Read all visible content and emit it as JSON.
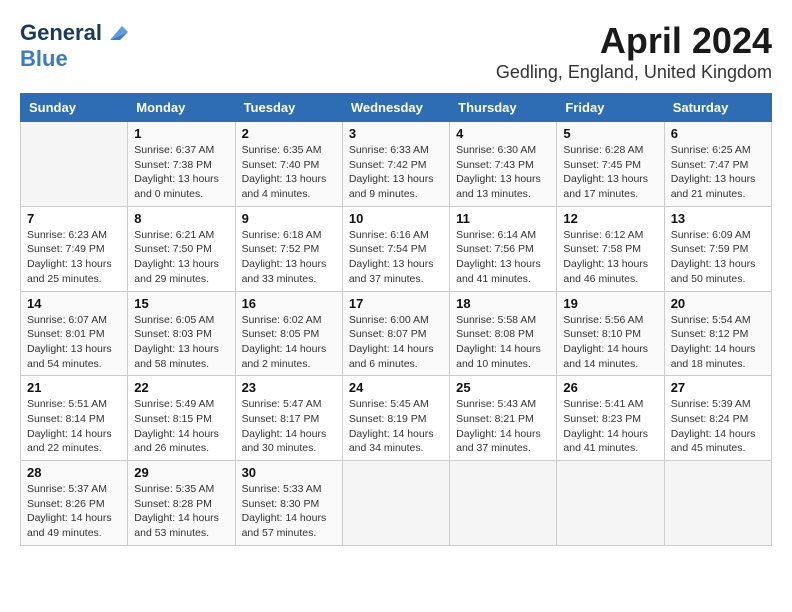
{
  "logo": {
    "general": "General",
    "blue": "Blue"
  },
  "title": "April 2024",
  "subtitle": "Gedling, England, United Kingdom",
  "days_of_week": [
    "Sunday",
    "Monday",
    "Tuesday",
    "Wednesday",
    "Thursday",
    "Friday",
    "Saturday"
  ],
  "weeks": [
    [
      {
        "day": "",
        "sunrise": "",
        "sunset": "",
        "daylight": ""
      },
      {
        "day": "1",
        "sunrise": "Sunrise: 6:37 AM",
        "sunset": "Sunset: 7:38 PM",
        "daylight": "Daylight: 13 hours and 0 minutes."
      },
      {
        "day": "2",
        "sunrise": "Sunrise: 6:35 AM",
        "sunset": "Sunset: 7:40 PM",
        "daylight": "Daylight: 13 hours and 4 minutes."
      },
      {
        "day": "3",
        "sunrise": "Sunrise: 6:33 AM",
        "sunset": "Sunset: 7:42 PM",
        "daylight": "Daylight: 13 hours and 9 minutes."
      },
      {
        "day": "4",
        "sunrise": "Sunrise: 6:30 AM",
        "sunset": "Sunset: 7:43 PM",
        "daylight": "Daylight: 13 hours and 13 minutes."
      },
      {
        "day": "5",
        "sunrise": "Sunrise: 6:28 AM",
        "sunset": "Sunset: 7:45 PM",
        "daylight": "Daylight: 13 hours and 17 minutes."
      },
      {
        "day": "6",
        "sunrise": "Sunrise: 6:25 AM",
        "sunset": "Sunset: 7:47 PM",
        "daylight": "Daylight: 13 hours and 21 minutes."
      }
    ],
    [
      {
        "day": "7",
        "sunrise": "Sunrise: 6:23 AM",
        "sunset": "Sunset: 7:49 PM",
        "daylight": "Daylight: 13 hours and 25 minutes."
      },
      {
        "day": "8",
        "sunrise": "Sunrise: 6:21 AM",
        "sunset": "Sunset: 7:50 PM",
        "daylight": "Daylight: 13 hours and 29 minutes."
      },
      {
        "day": "9",
        "sunrise": "Sunrise: 6:18 AM",
        "sunset": "Sunset: 7:52 PM",
        "daylight": "Daylight: 13 hours and 33 minutes."
      },
      {
        "day": "10",
        "sunrise": "Sunrise: 6:16 AM",
        "sunset": "Sunset: 7:54 PM",
        "daylight": "Daylight: 13 hours and 37 minutes."
      },
      {
        "day": "11",
        "sunrise": "Sunrise: 6:14 AM",
        "sunset": "Sunset: 7:56 PM",
        "daylight": "Daylight: 13 hours and 41 minutes."
      },
      {
        "day": "12",
        "sunrise": "Sunrise: 6:12 AM",
        "sunset": "Sunset: 7:58 PM",
        "daylight": "Daylight: 13 hours and 46 minutes."
      },
      {
        "day": "13",
        "sunrise": "Sunrise: 6:09 AM",
        "sunset": "Sunset: 7:59 PM",
        "daylight": "Daylight: 13 hours and 50 minutes."
      }
    ],
    [
      {
        "day": "14",
        "sunrise": "Sunrise: 6:07 AM",
        "sunset": "Sunset: 8:01 PM",
        "daylight": "Daylight: 13 hours and 54 minutes."
      },
      {
        "day": "15",
        "sunrise": "Sunrise: 6:05 AM",
        "sunset": "Sunset: 8:03 PM",
        "daylight": "Daylight: 13 hours and 58 minutes."
      },
      {
        "day": "16",
        "sunrise": "Sunrise: 6:02 AM",
        "sunset": "Sunset: 8:05 PM",
        "daylight": "Daylight: 14 hours and 2 minutes."
      },
      {
        "day": "17",
        "sunrise": "Sunrise: 6:00 AM",
        "sunset": "Sunset: 8:07 PM",
        "daylight": "Daylight: 14 hours and 6 minutes."
      },
      {
        "day": "18",
        "sunrise": "Sunrise: 5:58 AM",
        "sunset": "Sunset: 8:08 PM",
        "daylight": "Daylight: 14 hours and 10 minutes."
      },
      {
        "day": "19",
        "sunrise": "Sunrise: 5:56 AM",
        "sunset": "Sunset: 8:10 PM",
        "daylight": "Daylight: 14 hours and 14 minutes."
      },
      {
        "day": "20",
        "sunrise": "Sunrise: 5:54 AM",
        "sunset": "Sunset: 8:12 PM",
        "daylight": "Daylight: 14 hours and 18 minutes."
      }
    ],
    [
      {
        "day": "21",
        "sunrise": "Sunrise: 5:51 AM",
        "sunset": "Sunset: 8:14 PM",
        "daylight": "Daylight: 14 hours and 22 minutes."
      },
      {
        "day": "22",
        "sunrise": "Sunrise: 5:49 AM",
        "sunset": "Sunset: 8:15 PM",
        "daylight": "Daylight: 14 hours and 26 minutes."
      },
      {
        "day": "23",
        "sunrise": "Sunrise: 5:47 AM",
        "sunset": "Sunset: 8:17 PM",
        "daylight": "Daylight: 14 hours and 30 minutes."
      },
      {
        "day": "24",
        "sunrise": "Sunrise: 5:45 AM",
        "sunset": "Sunset: 8:19 PM",
        "daylight": "Daylight: 14 hours and 34 minutes."
      },
      {
        "day": "25",
        "sunrise": "Sunrise: 5:43 AM",
        "sunset": "Sunset: 8:21 PM",
        "daylight": "Daylight: 14 hours and 37 minutes."
      },
      {
        "day": "26",
        "sunrise": "Sunrise: 5:41 AM",
        "sunset": "Sunset: 8:23 PM",
        "daylight": "Daylight: 14 hours and 41 minutes."
      },
      {
        "day": "27",
        "sunrise": "Sunrise: 5:39 AM",
        "sunset": "Sunset: 8:24 PM",
        "daylight": "Daylight: 14 hours and 45 minutes."
      }
    ],
    [
      {
        "day": "28",
        "sunrise": "Sunrise: 5:37 AM",
        "sunset": "Sunset: 8:26 PM",
        "daylight": "Daylight: 14 hours and 49 minutes."
      },
      {
        "day": "29",
        "sunrise": "Sunrise: 5:35 AM",
        "sunset": "Sunset: 8:28 PM",
        "daylight": "Daylight: 14 hours and 53 minutes."
      },
      {
        "day": "30",
        "sunrise": "Sunrise: 5:33 AM",
        "sunset": "Sunset: 8:30 PM",
        "daylight": "Daylight: 14 hours and 57 minutes."
      },
      {
        "day": "",
        "sunrise": "",
        "sunset": "",
        "daylight": ""
      },
      {
        "day": "",
        "sunrise": "",
        "sunset": "",
        "daylight": ""
      },
      {
        "day": "",
        "sunrise": "",
        "sunset": "",
        "daylight": ""
      },
      {
        "day": "",
        "sunrise": "",
        "sunset": "",
        "daylight": ""
      }
    ]
  ]
}
